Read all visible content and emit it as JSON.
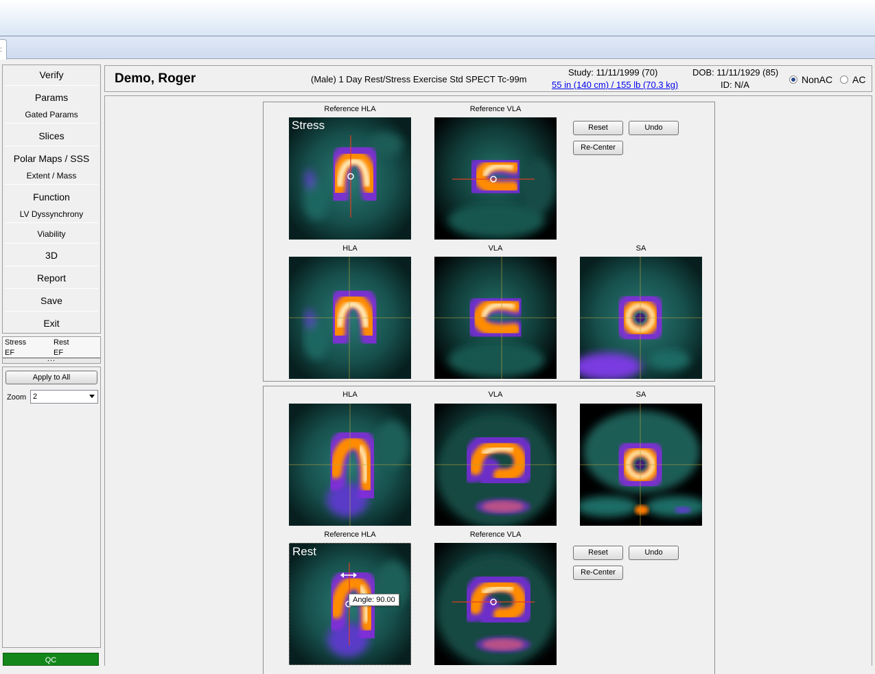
{
  "sidebar": {
    "verify": "Verify",
    "params": "Params",
    "gated_params": "Gated Params",
    "slices": "Slices",
    "polar_maps": "Polar Maps / SSS",
    "extent_mass": "Extent / Mass",
    "function": "Function",
    "lv_dyssynchrony": "LV Dyssynchrony",
    "viability": "Viability",
    "three_d": "3D",
    "report": "Report",
    "save": "Save",
    "exit": "Exit"
  },
  "ef": {
    "stress_label": "Stress",
    "stress_ef": "EF",
    "rest_label": "Rest",
    "rest_ef": "EF",
    "more": "..."
  },
  "controls": {
    "apply_all": "Apply to All",
    "zoom_label": "Zoom",
    "zoom_value": "2",
    "qc": "QC"
  },
  "header": {
    "patient_name": "Demo, Roger",
    "study_description": "(Male) 1 Day Rest/Stress Exercise Std SPECT Tc-99m",
    "study_date": "Study: 11/11/1999 (70)",
    "height_weight": "55 in (140 cm) / 155 lb (70.3 kg)",
    "dob": "DOB: 11/11/1929 (85)",
    "id": "ID: N/A",
    "nonac": "NonAC",
    "ac": "AC",
    "selected": "NonAC"
  },
  "stress": {
    "title": "Stress",
    "ref_hla": "Reference HLA",
    "ref_vla": "Reference VLA",
    "hla": "HLA",
    "vla": "VLA",
    "sa": "SA",
    "reset": "Reset",
    "undo": "Undo",
    "recenter": "Re-Center"
  },
  "rest": {
    "title": "Rest",
    "ref_hla": "Reference HLA",
    "ref_vla": "Reference VLA",
    "hla": "HLA",
    "vla": "VLA",
    "sa": "SA",
    "reset": "Reset",
    "undo": "Undo",
    "recenter": "Re-Center",
    "tooltip": "Angle: 90.00"
  },
  "colors": {
    "qc_green": "#13871a",
    "link_blue": "#0000ee"
  }
}
